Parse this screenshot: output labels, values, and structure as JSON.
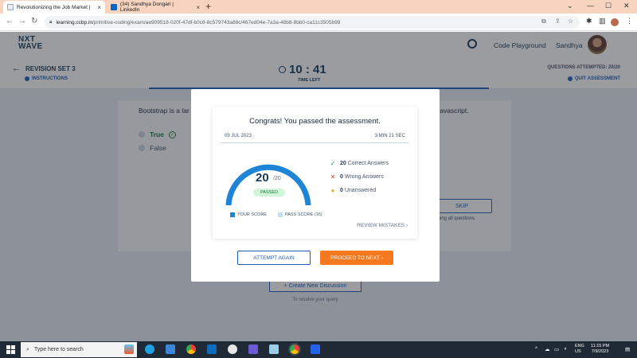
{
  "browser": {
    "tabs": [
      {
        "title": "Revolutionizing the Job Market |",
        "active": true
      },
      {
        "title": "(34) Sandhya Dongari | LinkedIn",
        "active": false
      }
    ],
    "url_host": "learning.ccbp.in",
    "url_path": "/primitive-coding/exam/ae909518-020f-47df-b0c8-8c579743a88c/467ed04e-7a3a-48b8-8bb0-ca11c3505b99"
  },
  "app": {
    "logo_top": "NXT",
    "logo_bottom": "WAVE",
    "playground": "Code Playground",
    "user": "Sandhya"
  },
  "exam": {
    "set_title": "REVISION SET 3",
    "instructions": "INSTRUCTIONS",
    "timer": "10 : 41",
    "timer_label": "TIME LEFT",
    "attempted": "QUESTIONS ATTEMPTED: 20/20",
    "quit": "QUIT ASSESSMENT"
  },
  "question": {
    "text_left": "Bootstrap is a lar",
    "text_right": "Javascript.",
    "options": [
      {
        "label": "True",
        "correct": true
      },
      {
        "label": "False",
        "correct": false
      }
    ],
    "skip": "SKIP",
    "skip_note": "nishing all questions."
  },
  "discussion": {
    "button": "+ Create New Discussion",
    "note": "To resolve your query"
  },
  "modal": {
    "title": "Congrats! You passed the assessment.",
    "date": "09 JUL 2023",
    "duration": "3 MIN 21 SEC",
    "score": "20",
    "total": "/20",
    "status": "PASSED",
    "score_fraction": 1.0,
    "pass_fraction": 0.8,
    "legend_your": "YOUR SCORE",
    "legend_pass": "PASS SCORE (16)",
    "stats": [
      {
        "count": "20",
        "label": "Correct Answers",
        "icon": "check-icon",
        "color": "#1f9d55"
      },
      {
        "count": "0",
        "label": "Wrong Answers",
        "icon": "cross-icon",
        "color": "#e0402e"
      },
      {
        "count": "0",
        "label": "Unanswered",
        "icon": "dot-icon",
        "color": "#e2b325"
      }
    ],
    "review": "REVIEW MISTAKES",
    "attempt_again": "ATTEMPT AGAIN",
    "proceed": "PROCEED TO NEXT"
  },
  "taskbar": {
    "search": "Type here to search",
    "lang1": "ENG",
    "lang2": "US",
    "time": "11:15 PM",
    "date": "7/9/2023"
  },
  "colors": {
    "brand": "#183b56",
    "primary": "#1e5fb8",
    "accent": "#f6781f",
    "gauge_fill": "#1e84d6",
    "gauge_pass": "#bfe0f7"
  }
}
